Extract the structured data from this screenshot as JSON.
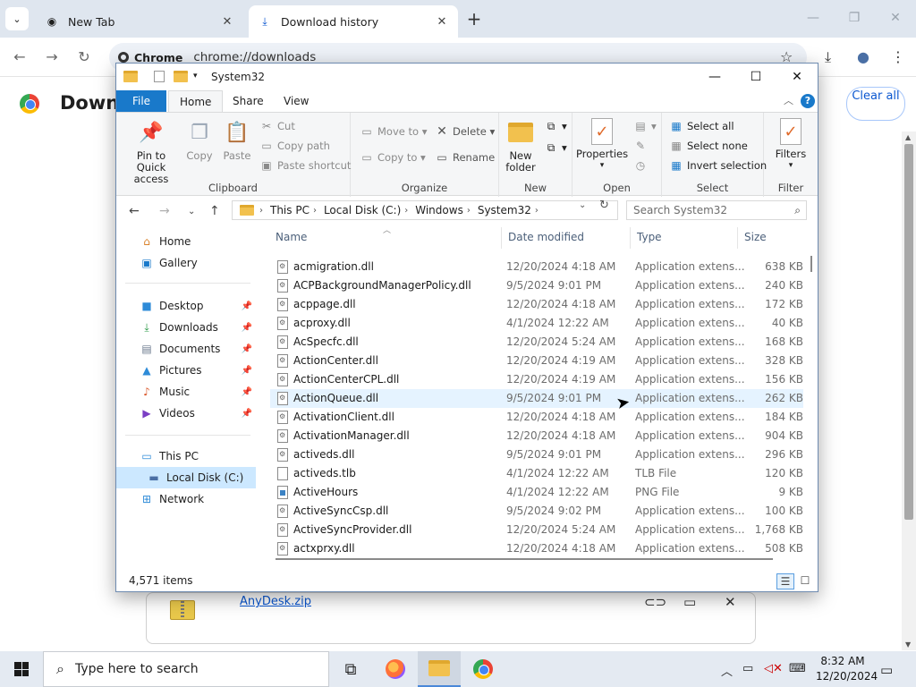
{
  "chrome": {
    "tabs": [
      {
        "title": "New Tab",
        "icon": "chrome-icon"
      },
      {
        "title": "Download history",
        "icon": "download-icon"
      }
    ],
    "omnibox": {
      "chip": "Chrome",
      "url": "chrome://downloads"
    },
    "page": {
      "title": "Downloads",
      "clear_all": "Clear all",
      "item": {
        "filename": "AnyDesk.zip"
      }
    }
  },
  "explorer": {
    "title": "System32",
    "ribbon_tabs": [
      "File",
      "Home",
      "Share",
      "View"
    ],
    "groups": {
      "clipboard": {
        "label": "Clipboard",
        "pin": "Pin to Quick access",
        "copy": "Copy",
        "paste": "Paste",
        "cut": "Cut",
        "copy_path": "Copy path",
        "paste_shortcut": "Paste shortcut"
      },
      "organize": {
        "label": "Organize",
        "move_to": "Move to",
        "copy_to": "Copy to",
        "delete": "Delete",
        "rename": "Rename"
      },
      "new": {
        "label": "New",
        "new_folder": "New folder"
      },
      "open": {
        "label": "Open",
        "properties": "Properties"
      },
      "select": {
        "label": "Select",
        "select_all": "Select all",
        "select_none": "Select none",
        "invert": "Invert selection"
      },
      "filters": {
        "label": "Filter",
        "filters": "Filters"
      }
    },
    "breadcrumb": [
      "This PC",
      "Local Disk (C:)",
      "Windows",
      "System32"
    ],
    "search_placeholder": "Search System32",
    "nav": {
      "home": "Home",
      "gallery": "Gallery",
      "desktop": "Desktop",
      "downloads": "Downloads",
      "documents": "Documents",
      "pictures": "Pictures",
      "music": "Music",
      "videos": "Videos",
      "this_pc": "This PC",
      "local_disk": "Local Disk (C:)",
      "network": "Network"
    },
    "columns": {
      "name": "Name",
      "date": "Date modified",
      "type": "Type",
      "size": "Size"
    },
    "files": [
      {
        "name": "acmigration.dll",
        "date": "12/20/2024 4:18 AM",
        "type": "Application extens...",
        "size": "638 KB",
        "kind": "dll"
      },
      {
        "name": "ACPBackgroundManagerPolicy.dll",
        "date": "9/5/2024 9:01 PM",
        "type": "Application extens...",
        "size": "240 KB",
        "kind": "dll"
      },
      {
        "name": "acppage.dll",
        "date": "12/20/2024 4:18 AM",
        "type": "Application extens...",
        "size": "172 KB",
        "kind": "dll"
      },
      {
        "name": "acproxy.dll",
        "date": "4/1/2024 12:22 AM",
        "type": "Application extens...",
        "size": "40 KB",
        "kind": "dll"
      },
      {
        "name": "AcSpecfc.dll",
        "date": "12/20/2024 5:24 AM",
        "type": "Application extens...",
        "size": "168 KB",
        "kind": "dll"
      },
      {
        "name": "ActionCenter.dll",
        "date": "12/20/2024 4:19 AM",
        "type": "Application extens...",
        "size": "328 KB",
        "kind": "dll"
      },
      {
        "name": "ActionCenterCPL.dll",
        "date": "12/20/2024 4:19 AM",
        "type": "Application extens...",
        "size": "156 KB",
        "kind": "dll"
      },
      {
        "name": "ActionQueue.dll",
        "date": "9/5/2024 9:01 PM",
        "type": "Application extens...",
        "size": "262 KB",
        "kind": "dll"
      },
      {
        "name": "ActivationClient.dll",
        "date": "12/20/2024 4:18 AM",
        "type": "Application extens...",
        "size": "184 KB",
        "kind": "dll"
      },
      {
        "name": "ActivationManager.dll",
        "date": "12/20/2024 4:18 AM",
        "type": "Application extens...",
        "size": "904 KB",
        "kind": "dll"
      },
      {
        "name": "activeds.dll",
        "date": "9/5/2024 9:01 PM",
        "type": "Application extens...",
        "size": "296 KB",
        "kind": "dll"
      },
      {
        "name": "activeds.tlb",
        "date": "4/1/2024 12:22 AM",
        "type": "TLB File",
        "size": "120 KB",
        "kind": "tlb"
      },
      {
        "name": "ActiveHours",
        "date": "4/1/2024 12:22 AM",
        "type": "PNG File",
        "size": "9 KB",
        "kind": "png"
      },
      {
        "name": "ActiveSyncCsp.dll",
        "date": "9/5/2024 9:02 PM",
        "type": "Application extens...",
        "size": "100 KB",
        "kind": "dll"
      },
      {
        "name": "ActiveSyncProvider.dll",
        "date": "12/20/2024 5:24 AM",
        "type": "Application extens...",
        "size": "1,768 KB",
        "kind": "dll"
      },
      {
        "name": "actxprxy.dll",
        "date": "12/20/2024 4:18 AM",
        "type": "Application extens...",
        "size": "508 KB",
        "kind": "dll"
      }
    ],
    "status": "4,571 items"
  },
  "taskbar": {
    "search_placeholder": "Type here to search",
    "time": "8:32 AM",
    "date": "12/20/2024"
  }
}
